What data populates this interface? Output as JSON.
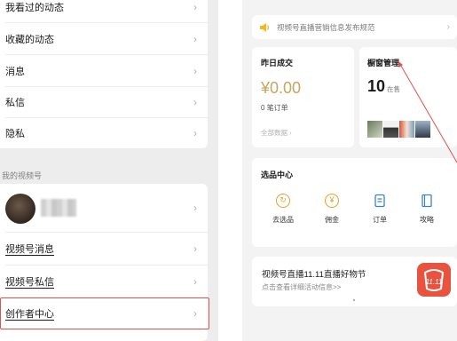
{
  "left": {
    "settings_items": [
      {
        "label": "我看过的动态"
      },
      {
        "label": "收藏的动态"
      },
      {
        "label": "消息"
      },
      {
        "label": "私信"
      },
      {
        "label": "隐私"
      }
    ],
    "section_label": "我的视频号",
    "channel_items": [
      {
        "label": "视频号消息"
      },
      {
        "label": "视频号私信"
      },
      {
        "label": "创作者中心"
      }
    ],
    "chevron": "›"
  },
  "right": {
    "notice": {
      "text": "视频号直播营销信息发布规范",
      "icon": "speaker-icon"
    },
    "sales": {
      "title": "昨日成交",
      "amount": "¥0.00",
      "orders": "0 笔订单",
      "all_data": "全部数据 ›"
    },
    "window": {
      "title": "橱窗管理",
      "count": "10",
      "count_label": "在售"
    },
    "selection": {
      "title": "选品中心",
      "tools": [
        {
          "label": "去选品",
          "icon": "select-product-icon"
        },
        {
          "label": "佣金",
          "icon": "yen-icon"
        },
        {
          "label": "订单",
          "icon": "order-icon"
        },
        {
          "label": "攻略",
          "icon": "guide-book-icon"
        }
      ]
    },
    "promo": {
      "title": "视频号直播11.11直播好物节",
      "subtitle": "点击查看详细活动信息>>",
      "logo_text": "11.11"
    }
  },
  "colors": {
    "highlight": "#e25151",
    "gold": "#c9a55e",
    "orange": "#e5a02a",
    "blue": "#3b82c4",
    "promo": "#e8533f"
  }
}
